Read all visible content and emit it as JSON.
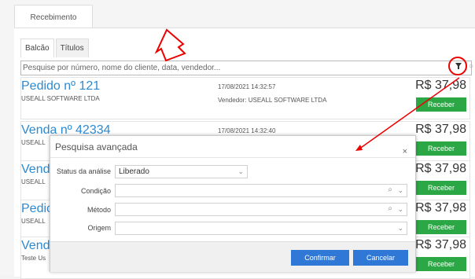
{
  "window": {
    "tab_label": "Recebimento"
  },
  "tabs": [
    {
      "label": "Balcão"
    },
    {
      "label": "Títulos"
    }
  ],
  "search": {
    "placeholder": "Pesquise por número, nome do cliente, data, vendedor..."
  },
  "icons": {
    "filter": "filter-icon",
    "close": "close-icon",
    "search": "search-icon",
    "chevron": "chevron-down-icon"
  },
  "rows": [
    {
      "title": "Pedido nº 121",
      "company": "USEALL SOFTWARE LTDA",
      "date": "17/08/2021 14:32:57",
      "seller": "Vendedor: USEALL SOFTWARE LTDA",
      "price": "R$ 37,98",
      "button": "Receber"
    },
    {
      "title": "Venda nº 42334",
      "company": "USEALL",
      "date": "17/08/2021 14:32:40",
      "seller": "",
      "price": "R$ 37,98",
      "button": "Receber"
    },
    {
      "title": "Vend",
      "company": "USEALL",
      "date": "",
      "seller": "",
      "price": "R$ 37,98",
      "button": "Receber"
    },
    {
      "title": "Pedic",
      "company": "USEALL",
      "date": "",
      "seller": "",
      "price": "R$ 37,98",
      "button": "Receber"
    },
    {
      "title": "Vend",
      "company": "Teste Us",
      "date": "",
      "seller": "",
      "price": "R$ 37,98",
      "button": "Receber"
    }
  ],
  "modal": {
    "title": "Pesquisa avançada",
    "close": "×",
    "fields": [
      {
        "label": "Status da análise",
        "value": "Liberado"
      },
      {
        "label": "Condição",
        "value": ""
      },
      {
        "label": "Método",
        "value": ""
      },
      {
        "label": "Origem",
        "value": ""
      }
    ],
    "confirm": "Confirmar",
    "cancel": "Cancelar"
  },
  "colors": {
    "accent": "#2f78d6",
    "green": "#2ba845",
    "link": "#2c8ad2",
    "annotation": "#e00000"
  }
}
